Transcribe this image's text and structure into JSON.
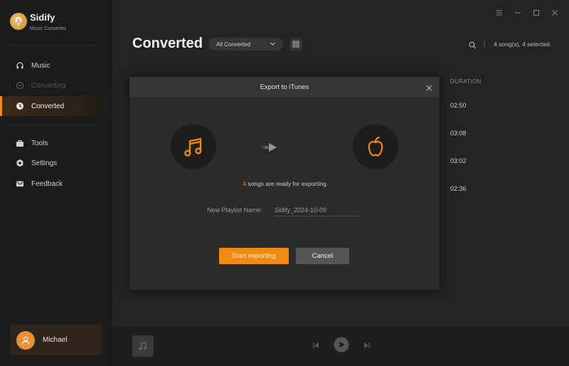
{
  "app": {
    "name": "Sidify",
    "subtitle": "Music Converter"
  },
  "sidebar": {
    "items": [
      {
        "label": "Music",
        "icon": "headphones-icon"
      },
      {
        "label": "Converting",
        "icon": "converting-icon"
      },
      {
        "label": "Converted",
        "icon": "clock-icon"
      },
      {
        "label": "Tools",
        "icon": "toolbox-icon"
      },
      {
        "label": "Settings",
        "icon": "gear-icon"
      },
      {
        "label": "Feedback",
        "icon": "mail-icon"
      }
    ],
    "user": {
      "name": "Michael"
    }
  },
  "header": {
    "title": "Converted",
    "filter": "All Converted",
    "count": "4 song(s), 4 selected."
  },
  "table": {
    "duration_header": "DURATION",
    "durations": [
      "02:50",
      "03:08",
      "03:02",
      "02:36"
    ]
  },
  "dialog": {
    "title": "Export to iTunes",
    "ready_count": "4",
    "ready_text": " songs are ready for exporting",
    "playlist_label": "New Playlist Name:",
    "playlist_value": "Sidify_2024-10-09",
    "start_label": "Start exporting",
    "cancel_label": "Cancel"
  },
  "colors": {
    "accent": "#f08a12",
    "background": "#232323",
    "sidebar": "#1b1b1b"
  }
}
